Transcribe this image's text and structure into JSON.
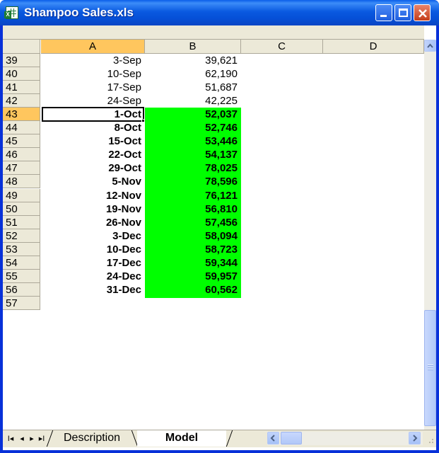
{
  "window": {
    "title": "Shampoo Sales.xls",
    "icon": "excel-file-icon"
  },
  "columns": [
    "A",
    "B",
    "C",
    "D"
  ],
  "active_column": "A",
  "active_row": "43",
  "rows": [
    {
      "num": "39",
      "a": "3-Sep",
      "b": "39,621",
      "highlight": false
    },
    {
      "num": "40",
      "a": "10-Sep",
      "b": "62,190",
      "highlight": false
    },
    {
      "num": "41",
      "a": "17-Sep",
      "b": "51,687",
      "highlight": false
    },
    {
      "num": "42",
      "a": "24-Sep",
      "b": "42,225",
      "highlight": false
    },
    {
      "num": "43",
      "a": "1-Oct",
      "b": "52,037",
      "highlight": true
    },
    {
      "num": "44",
      "a": "8-Oct",
      "b": "52,746",
      "highlight": true
    },
    {
      "num": "45",
      "a": "15-Oct",
      "b": "53,446",
      "highlight": true
    },
    {
      "num": "46",
      "a": "22-Oct",
      "b": "54,137",
      "highlight": true
    },
    {
      "num": "47",
      "a": "29-Oct",
      "b": "78,025",
      "highlight": true
    },
    {
      "num": "48",
      "a": "5-Nov",
      "b": "78,596",
      "highlight": true
    },
    {
      "num": "49",
      "a": "12-Nov",
      "b": "76,121",
      "highlight": true
    },
    {
      "num": "50",
      "a": "19-Nov",
      "b": "56,810",
      "highlight": true
    },
    {
      "num": "51",
      "a": "26-Nov",
      "b": "57,456",
      "highlight": true
    },
    {
      "num": "52",
      "a": "3-Dec",
      "b": "58,094",
      "highlight": true
    },
    {
      "num": "53",
      "a": "10-Dec",
      "b": "58,723",
      "highlight": true
    },
    {
      "num": "54",
      "a": "17-Dec",
      "b": "59,344",
      "highlight": true
    },
    {
      "num": "55",
      "a": "24-Dec",
      "b": "59,957",
      "highlight": true
    },
    {
      "num": "56",
      "a": "31-Dec",
      "b": "60,562",
      "highlight": true
    },
    {
      "num": "57",
      "a": "",
      "b": "",
      "highlight": false
    }
  ],
  "sheet_tabs": [
    {
      "label": "Description",
      "active": false
    },
    {
      "label": "Model",
      "active": true
    }
  ],
  "colors": {
    "highlight_fill": "#00ff00",
    "active_header": "#ffc65e",
    "title_bar": "#0a5ae0"
  }
}
